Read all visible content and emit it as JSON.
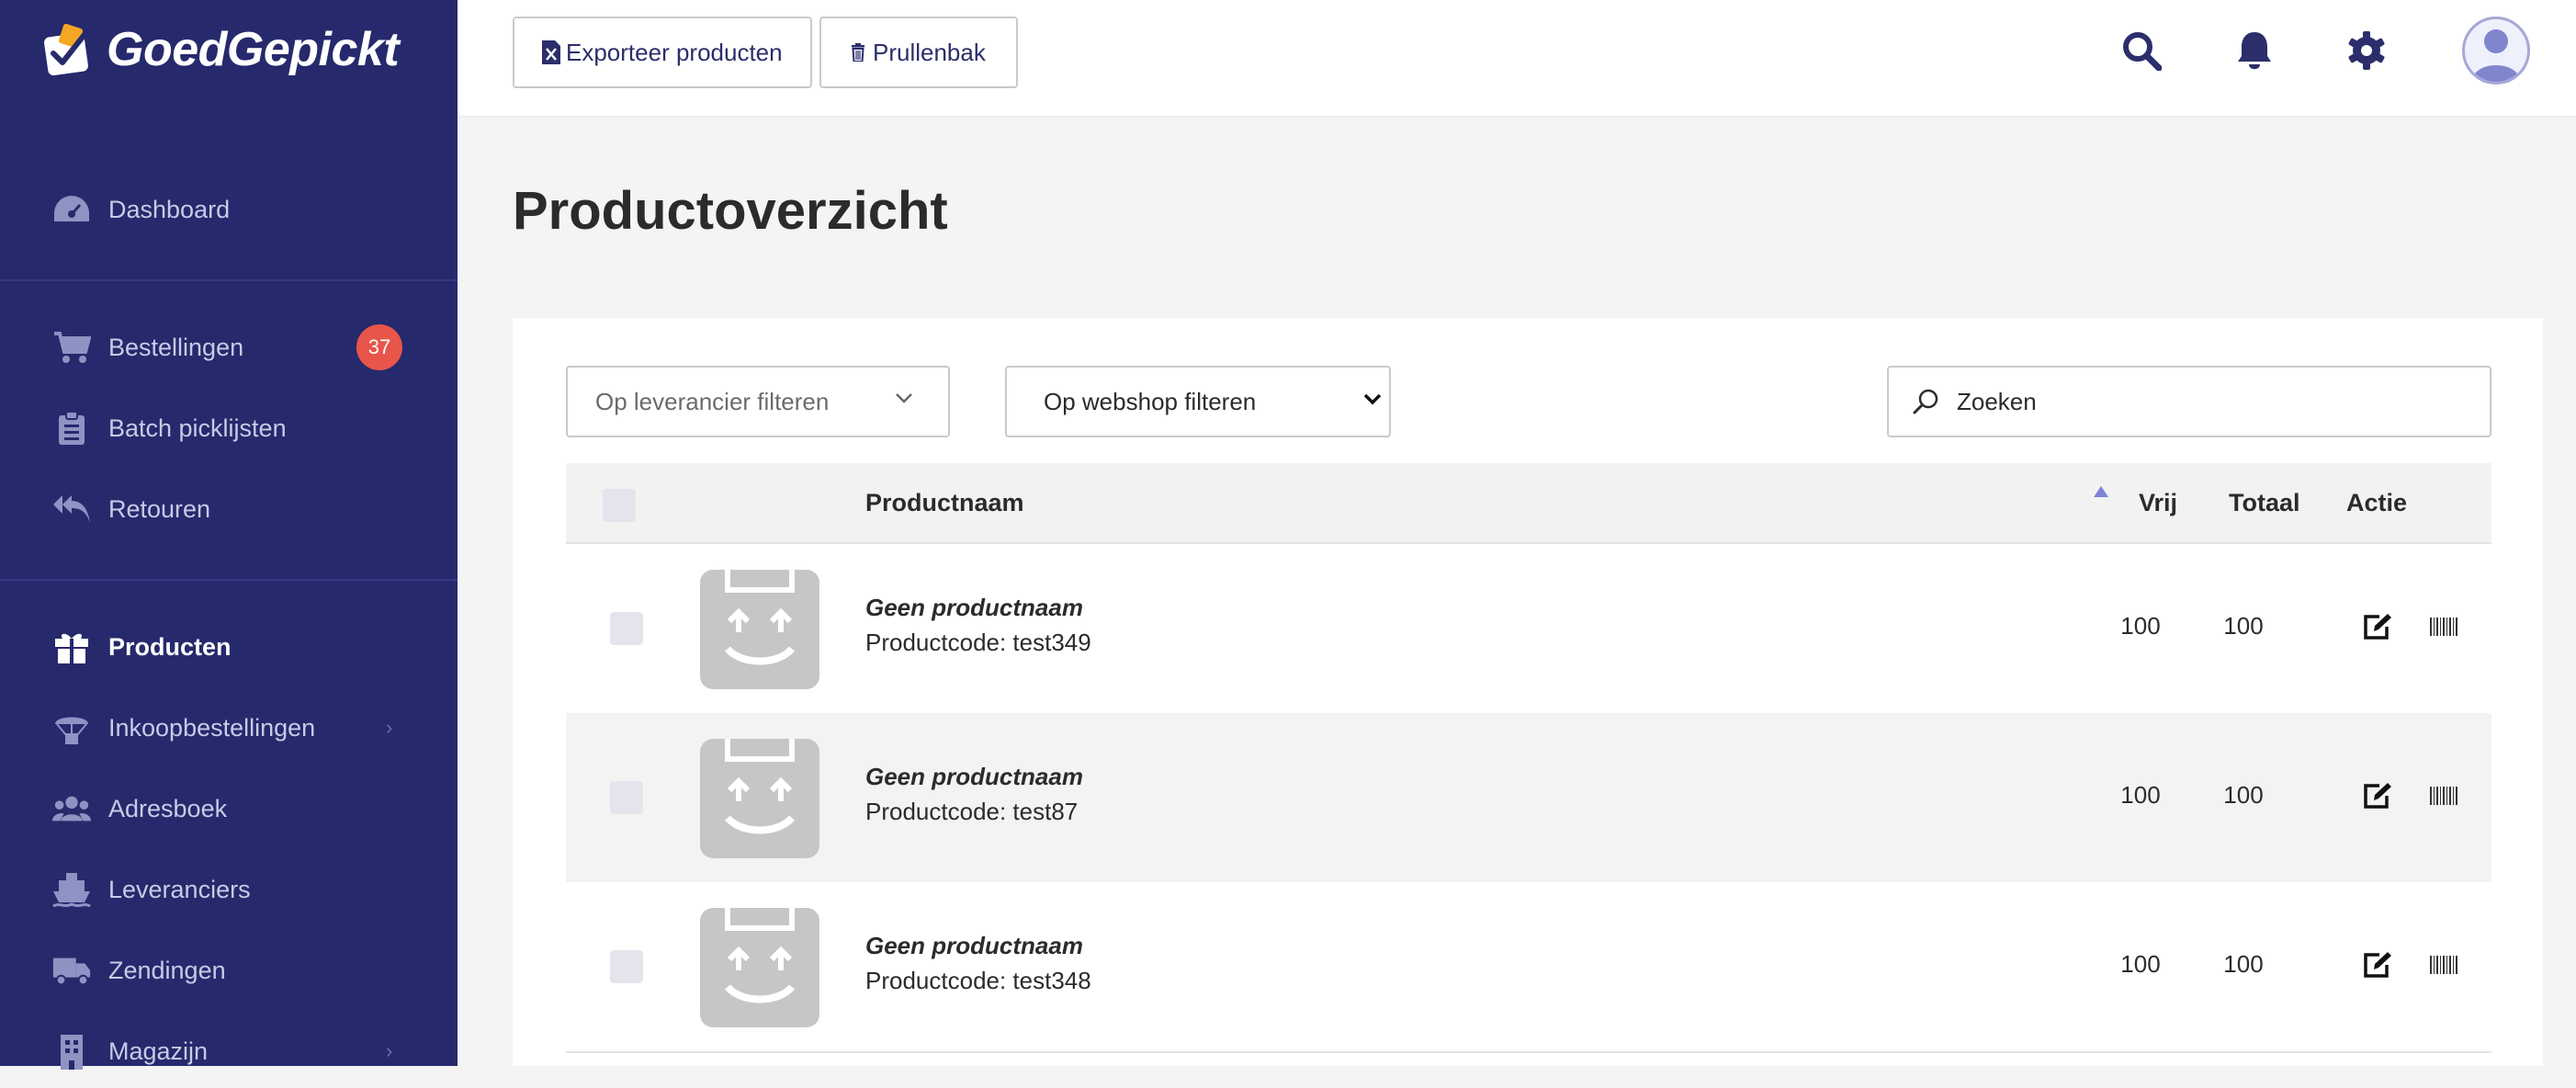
{
  "app": {
    "logo_text": "GoedGepickt"
  },
  "sidebar": {
    "items": [
      {
        "label": "Dashboard",
        "icon": "tachometer-icon"
      },
      {
        "label": "Bestellingen",
        "icon": "cart-icon",
        "badge": "37"
      },
      {
        "label": "Batch picklijsten",
        "icon": "clipboard-icon"
      },
      {
        "label": "Retouren",
        "icon": "reply-all-icon"
      },
      {
        "label": "Producten",
        "icon": "gift-icon",
        "active": true
      },
      {
        "label": "Inkoopbestellingen",
        "icon": "parachute-box-icon",
        "chevron": "›"
      },
      {
        "label": "Adresboek",
        "icon": "users-icon"
      },
      {
        "label": "Leveranciers",
        "icon": "ship-icon"
      },
      {
        "label": "Zendingen",
        "icon": "truck-icon"
      },
      {
        "label": "Magazijn",
        "icon": "building-icon",
        "chevron": "›"
      }
    ]
  },
  "header": {
    "export_label": "Exporteer producten",
    "trash_label": "Prullenbak",
    "icons": [
      "search-icon",
      "bell-icon",
      "gear-icon",
      "avatar"
    ]
  },
  "main": {
    "title": "Productoverzicht",
    "filters": {
      "supplier_placeholder": "Op leverancier filteren",
      "webshop_selected": "Op webshop filteren",
      "search_placeholder": "Zoeken"
    },
    "table": {
      "columns": {
        "name": "Productnaam",
        "free": "Vrij",
        "total": "Totaal",
        "action": "Actie"
      },
      "rows": [
        {
          "name": "Geen productnaam",
          "code": "Productcode: test349",
          "free": "100",
          "total": "100"
        },
        {
          "name": "Geen productnaam",
          "code": "Productcode: test87",
          "free": "100",
          "total": "100"
        },
        {
          "name": "Geen productnaam",
          "code": "Productcode: test348",
          "free": "100",
          "total": "100"
        }
      ]
    }
  },
  "colors": {
    "sidebar_bg": "#26296c",
    "accent": "#2b2e6b",
    "badge": "#e8554a",
    "sort_arrow": "#7b83d6"
  }
}
